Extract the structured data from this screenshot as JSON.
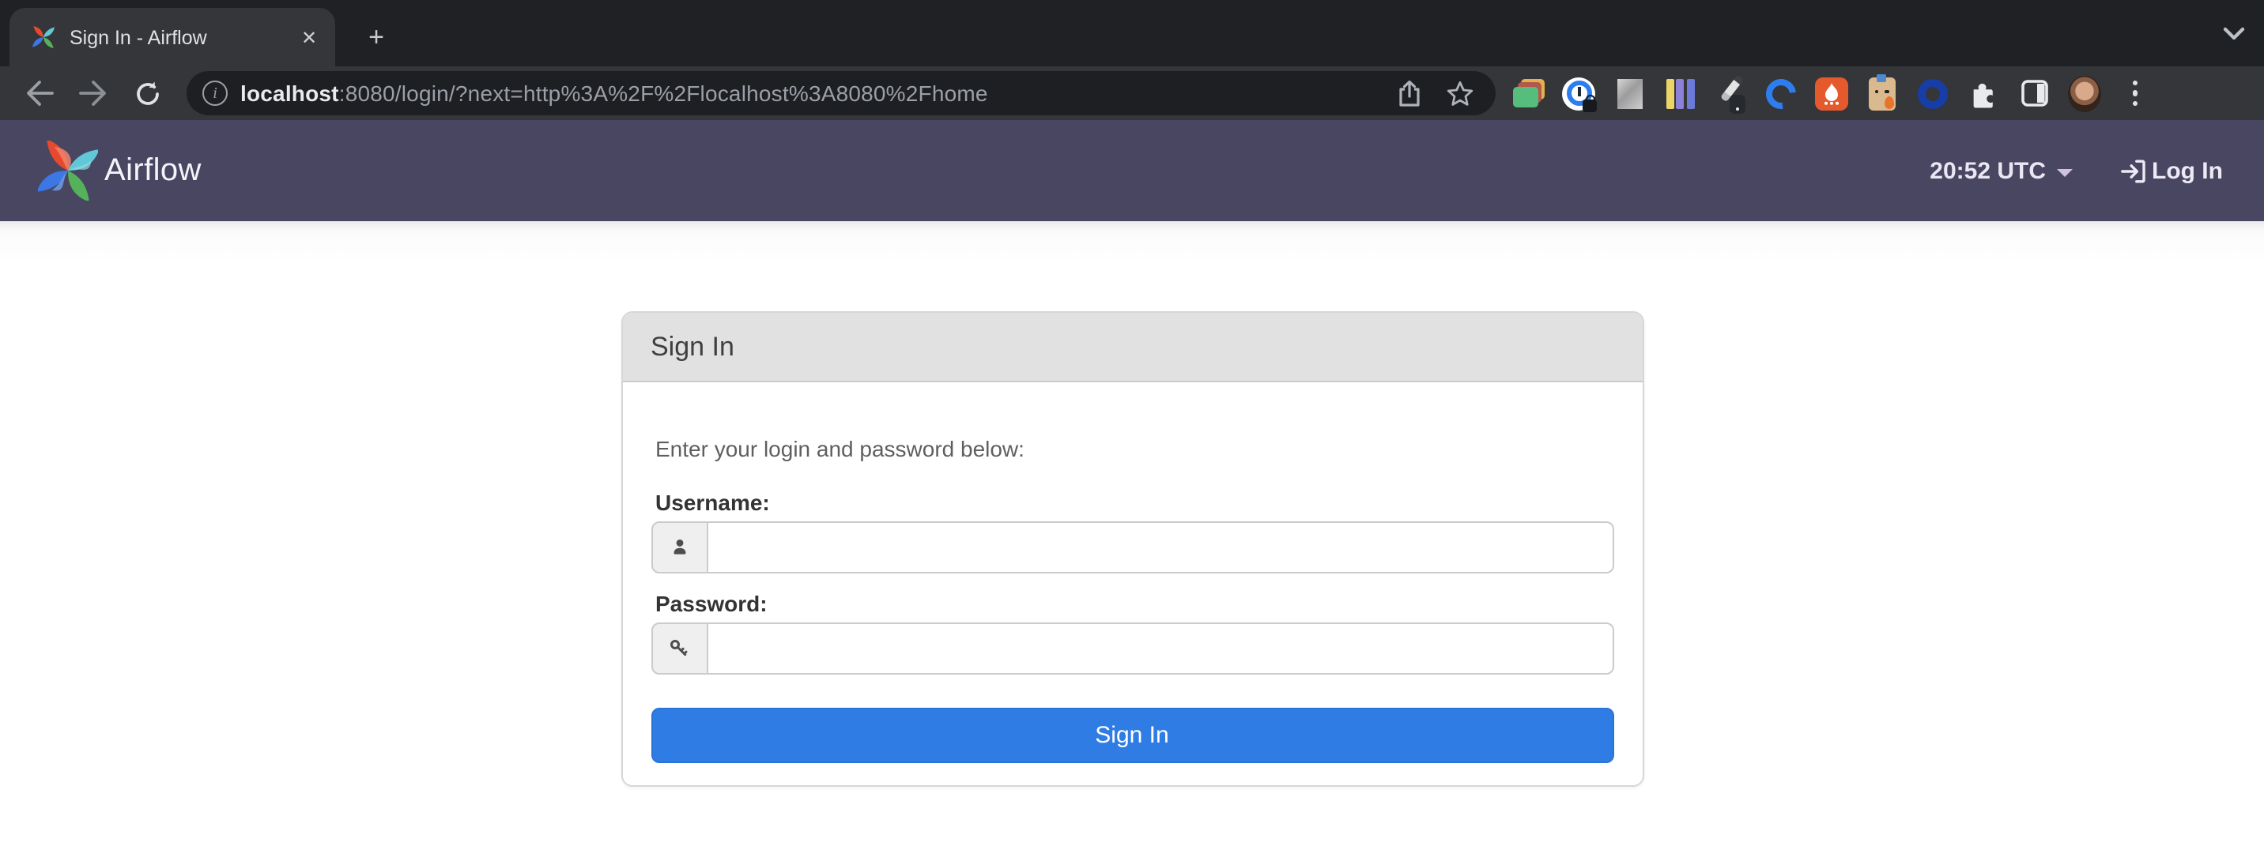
{
  "browser": {
    "tab_title": "Sign In - Airflow",
    "close_glyph": "✕",
    "new_tab_glyph": "+",
    "url_host": "localhost",
    "url_rest": ":8080/login/?next=http%3A%2F%2Flocalhost%3A8080%2Fhome",
    "info_glyph": "i",
    "extension_icons": [
      "folders-icon",
      "password-manager-icon",
      "screenshot-thumbnail-icon",
      "color-columns-icon",
      "highlighter-pen-icon",
      "blue-c-icon",
      "fire-icon",
      "clipboard-buddy-icon",
      "blue-ring-icon",
      "extensions-puzzle-icon",
      "side-panel-icon",
      "profile-avatar",
      "browser-menu-icon"
    ]
  },
  "navbar": {
    "brand": "Airflow",
    "clock": "20:52 UTC",
    "login_label": "Log In"
  },
  "signin": {
    "header": "Sign In",
    "instruction": "Enter your login and password below:",
    "username_label": "Username:",
    "password_label": "Password:",
    "username_value": "",
    "password_value": "",
    "submit_label": "Sign In"
  },
  "colors": {
    "navbar_bg": "#494662",
    "submit_blue": "#2f7de4",
    "card_header_bg": "#e1e1e1",
    "airflow_red": "#e8492e",
    "airflow_teal": "#62c8d7",
    "airflow_green": "#55b25a",
    "airflow_blue": "#3c77e6"
  }
}
